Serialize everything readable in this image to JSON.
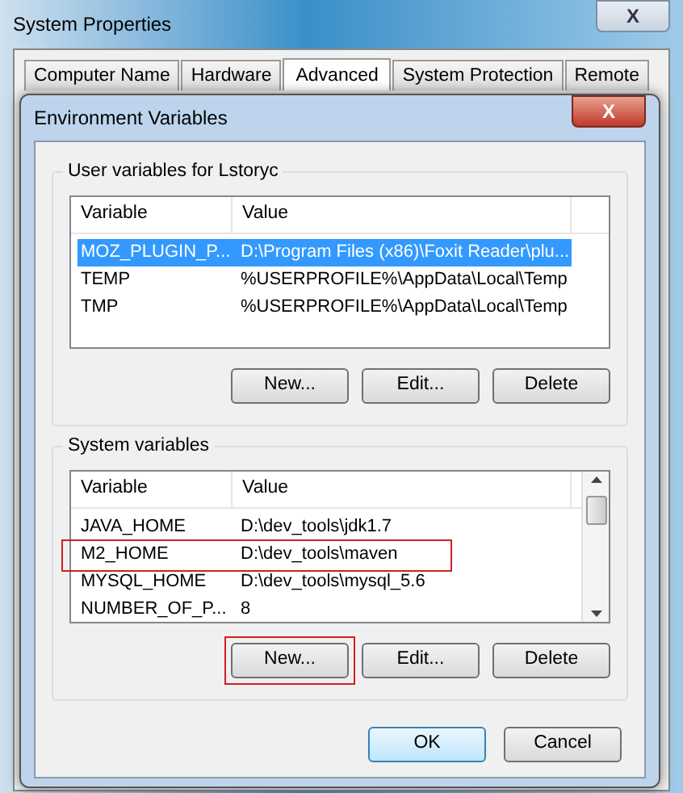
{
  "window": {
    "title": "System Properties",
    "close": "X"
  },
  "tabs": [
    {
      "label": "Computer Name",
      "selected": false
    },
    {
      "label": "Hardware",
      "selected": false
    },
    {
      "label": "Advanced",
      "selected": true
    },
    {
      "label": "System Protection",
      "selected": false
    },
    {
      "label": "Remote",
      "selected": false
    }
  ],
  "dialog": {
    "title": "Environment Variables",
    "close": "X",
    "groups": [
      {
        "title": "User variables for Lstoryc",
        "scrollbar": false,
        "columns": [
          "Variable",
          "Value"
        ],
        "rows": [
          {
            "cells": [
              "MOZ_PLUGIN_P...",
              "D:\\Program Files (x86)\\Foxit Reader\\plu..."
            ],
            "selected": true,
            "highlighted": false
          },
          {
            "cells": [
              "TEMP",
              "%USERPROFILE%\\AppData\\Local\\Temp"
            ],
            "selected": false,
            "highlighted": false
          },
          {
            "cells": [
              "TMP",
              "%USERPROFILE%\\AppData\\Local\\Temp"
            ],
            "selected": false,
            "highlighted": false
          }
        ],
        "buttons": [
          {
            "label": "New...",
            "highlighted": false
          },
          {
            "label": "Edit...",
            "highlighted": false
          },
          {
            "label": "Delete",
            "highlighted": false
          }
        ]
      },
      {
        "title": "System variables",
        "scrollbar": true,
        "columns": [
          "Variable",
          "Value"
        ],
        "rows": [
          {
            "cells": [
              "JAVA_HOME",
              "D:\\dev_tools\\jdk1.7"
            ],
            "selected": false,
            "highlighted": false
          },
          {
            "cells": [
              "M2_HOME",
              "D:\\dev_tools\\maven"
            ],
            "selected": false,
            "highlighted": true
          },
          {
            "cells": [
              "MYSQL_HOME",
              "D:\\dev_tools\\mysql_5.6"
            ],
            "selected": false,
            "highlighted": false
          },
          {
            "cells": [
              "NUMBER_OF_P...",
              "8"
            ],
            "selected": false,
            "highlighted": false
          }
        ],
        "buttons": [
          {
            "label": "New...",
            "highlighted": true
          },
          {
            "label": "Edit...",
            "highlighted": false
          },
          {
            "label": "Delete",
            "highlighted": false
          }
        ]
      }
    ],
    "buttons": [
      {
        "label": "OK",
        "default": true
      },
      {
        "label": "Cancel",
        "default": false
      }
    ]
  }
}
